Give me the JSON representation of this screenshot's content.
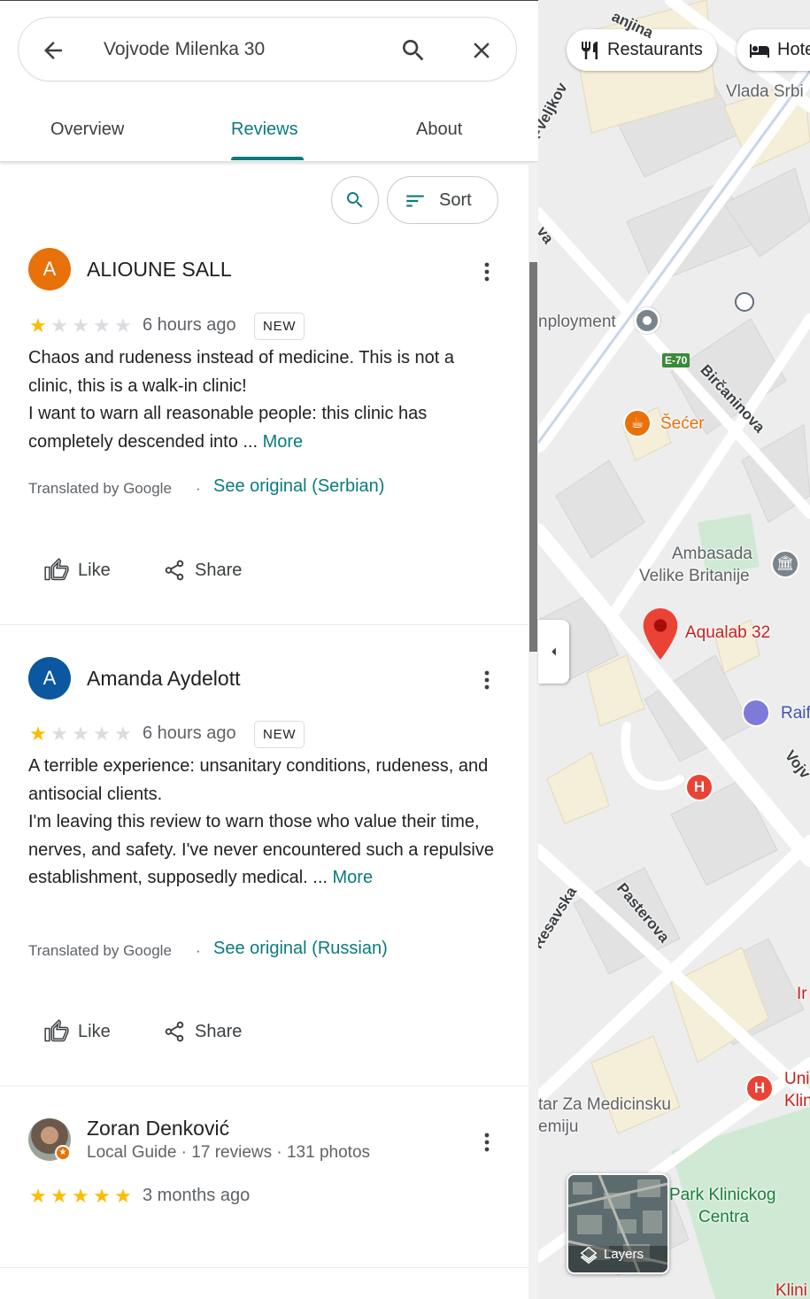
{
  "search": {
    "query": "Vojvode Milenka 30"
  },
  "tabs": [
    {
      "label": "Overview",
      "active": false
    },
    {
      "label": "Reviews",
      "active": true
    },
    {
      "label": "About",
      "active": false
    }
  ],
  "review_tools": {
    "sort_label": "Sort"
  },
  "reviews": [
    {
      "avatar_letter": "A",
      "avatar_color": "#e8710a",
      "author": "ALIOUNE SALL",
      "rating": 1,
      "when": "6 hours ago",
      "badge": "NEW",
      "body": "Chaos and rudeness instead of medicine. This is not a clinic, this is a walk-in clinic!\nI want to warn all reasonable people: this clinic has completely descended into ...",
      "more": "More",
      "translated": "Translated by Google",
      "dot": "·",
      "see_original": "See original (Serbian)",
      "like": "Like",
      "share": "Share"
    },
    {
      "avatar_letter": "A",
      "avatar_color": "#0b57a0",
      "author": "Amanda Aydelott",
      "rating": 1,
      "when": "6 hours ago",
      "badge": "NEW",
      "body": "A terrible experience: unsanitary conditions, rudeness, and antisocial clients.\nI'm leaving this review to warn those who value their time, nerves, and safety. I've never encountered such a repulsive establishment, supposedly medical. ...",
      "more": "More",
      "translated": "Translated by Google",
      "dot": "·",
      "see_original": "See original (Russian)",
      "like": "Like",
      "share": "Share"
    },
    {
      "author": "Zoran Denković",
      "subtitle": "Local Guide · 17 reviews · 131 photos",
      "rating": 5,
      "when": "3 months ago"
    }
  ],
  "map": {
    "chips": [
      {
        "label": "Restaurants",
        "icon": "fork-knife-icon"
      },
      {
        "label": "Hote",
        "icon": "bed-icon"
      }
    ],
    "labels": {
      "vlada": "Vlada Srbi",
      "employment": "nployment",
      "secer": "Šećer",
      "ambasada_1": "Ambasada",
      "ambasada_2": "Velike Britanije",
      "aqualab": "Aqualab 32",
      "raif": "Raif",
      "ir": "Ir",
      "uni_1": "Uni",
      "uni_2": "Klin",
      "centar_1": "tar Za Medicinsku",
      "centar_2": "emiju",
      "park_1": "Park Klinickog",
      "park_2": "Centra",
      "klini": "Klini"
    },
    "streets": {
      "top": "anjina",
      "veljkov": "k-Veljkov",
      "va": "va",
      "bircaninova": "Birčaninova",
      "vojv": "Vojv",
      "resavska": "Resavska",
      "pasterova": "Pasterova"
    },
    "highway_badge": "E-70",
    "layers_label": "Layers"
  }
}
